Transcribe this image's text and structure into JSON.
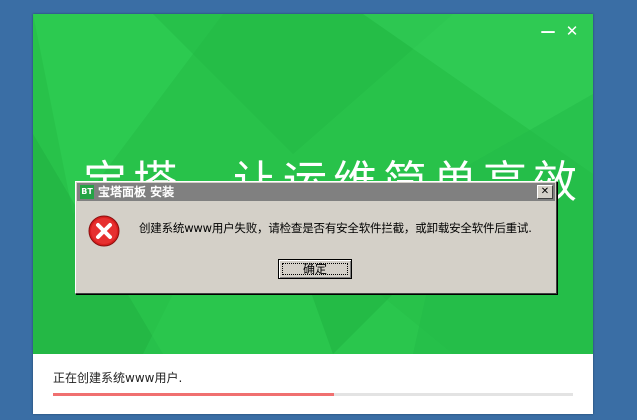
{
  "installer": {
    "slogan": "宝塔，让运维简单高效",
    "minimize_symbol": "—",
    "close_symbol": "✕",
    "status_text": "正在创建系统www用户.",
    "progress_fraction": 0.54,
    "colors": {
      "green": "#28c24a",
      "progress": "#f07070"
    }
  },
  "dialog": {
    "logo_text": "BT",
    "title": "宝塔面板 安装",
    "close_symbol": "✕",
    "icon": "error-icon",
    "message": "创建系统www用户失败，请检查是否有安全软件拦截，或卸载安全软件后重试.",
    "ok_label": "确定"
  }
}
